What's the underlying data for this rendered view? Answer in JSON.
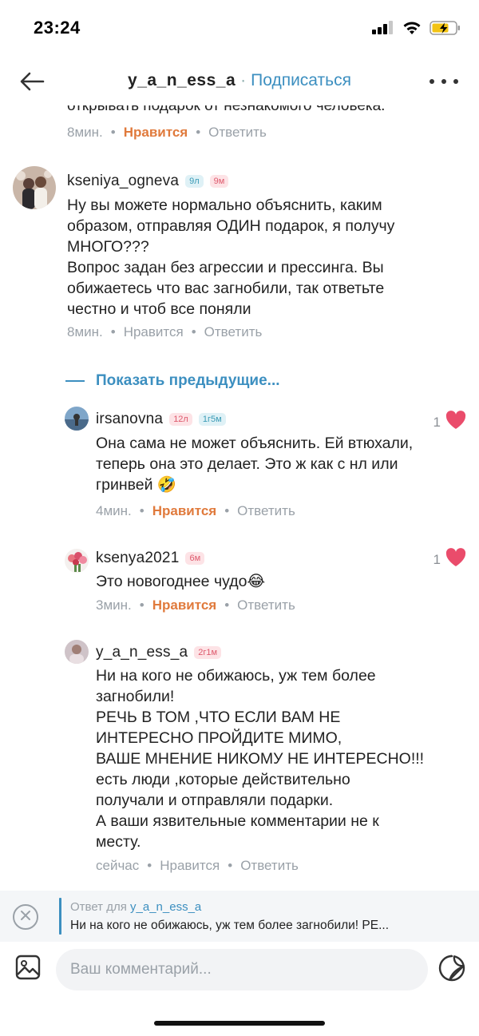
{
  "status_bar": {
    "time": "23:24"
  },
  "header": {
    "username": "y_a_n_ess_a",
    "separator": "·",
    "subscribe_label": "Подписаться"
  },
  "partial_comment": {
    "text_fragment": "открывать подарок от незнакомого человека.",
    "time": "8мин.",
    "like_label": "Нравится",
    "reply_label": "Ответить"
  },
  "comments": [
    {
      "username": "kseniya_ogneva",
      "badges": [
        "9л",
        "9м"
      ],
      "text": "Ну вы можете нормально объяснить, каким\nобразом, отправляя ОДИН подарок, я получу\nМНОГО???\nВопрос задан без агрессии и прессинга. Вы\nобижаетесь что вас загнобили, так ответьте\nчестно и чтоб все поняли",
      "time": "8мин.",
      "like_label": "Нравится",
      "reply_label": "Ответить"
    }
  ],
  "show_previous_label": "Показать предыдущие...",
  "replies": [
    {
      "username": "irsanovna",
      "badges": [
        "12л",
        "1г5м"
      ],
      "text": "Она сама не может объяснить. Ей втюхали,\nтеперь она это делает. Это ж как с нл или\nгринвей 🤣",
      "time": "4мин.",
      "like_label": "Нравится",
      "reply_label": "Ответить",
      "likes": "1"
    },
    {
      "username": "ksenya2021",
      "badges": [
        "6м"
      ],
      "text": "Это новогоднее чудо😂",
      "time": "3мин.",
      "like_label": "Нравится",
      "reply_label": "Ответить",
      "likes": "1"
    },
    {
      "username": "y_a_n_ess_a",
      "badges": [
        "2г1м"
      ],
      "text": "Ни на кого не обижаюсь, уж тем более\nзагнобили!\nРЕЧЬ В ТОМ ,ЧТО ЕСЛИ ВАМ НЕ\nИНТЕРЕСНО ПРОЙДИТЕ МИМО,\nВАШЕ МНЕНИЕ НИКОМУ НЕ ИНТЕРЕСНО!!!\nесть люди ,которые действительно\nполучали и отправляли подарки.\nА ваши язвительные комментарии не к\nместу.",
      "time": "сейчас",
      "like_label": "Нравится",
      "reply_label": "Ответить"
    }
  ],
  "reply_bar": {
    "prefix": "Ответ для",
    "username": "y_a_n_ess_a",
    "preview": "Ни на кого не обижаюсь, уж тем более загнобили!  РЕ..."
  },
  "input": {
    "placeholder": "Ваш комментарий..."
  },
  "colors": {
    "accent": "#3c8fc0",
    "liked": "#e07a3c",
    "heart": "#ea4c6b",
    "muted": "#9aa1a8"
  }
}
